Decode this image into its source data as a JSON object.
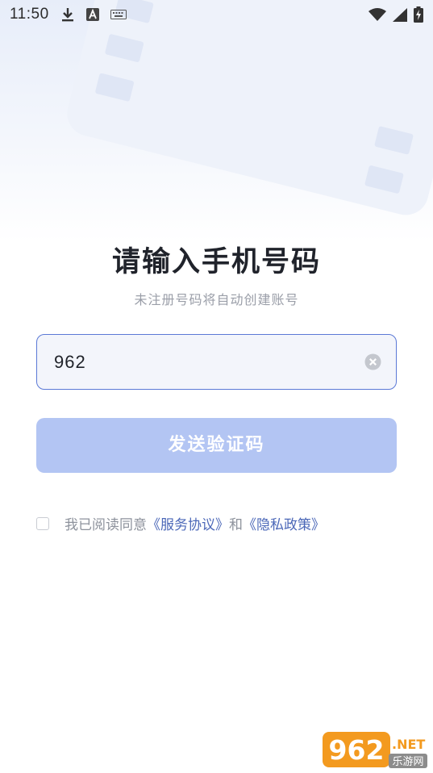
{
  "status_bar": {
    "time": "11:50",
    "left_icons": [
      "download-icon",
      "a-letter-icon",
      "keyboard-icon"
    ],
    "right_icons": [
      "wifi-icon",
      "signal-icon",
      "battery-charging-icon"
    ]
  },
  "login": {
    "title": "请输入手机号码",
    "subtitle": "未注册号码将自动创建账号",
    "phone_value": "962",
    "send_button": "发送验证码"
  },
  "agreement": {
    "prefix": "我已阅读同意",
    "service_link": "《服务协议》",
    "conjunction": "和",
    "privacy_link": "《隐私政策》",
    "checked": false
  },
  "watermark": {
    "number": "962",
    "suffix": ".NET",
    "site": "乐游网"
  },
  "colors": {
    "accent": "#5b79d6",
    "button_disabled": "#b3c5f3",
    "link": "#4c68b8",
    "title": "#20232b"
  }
}
